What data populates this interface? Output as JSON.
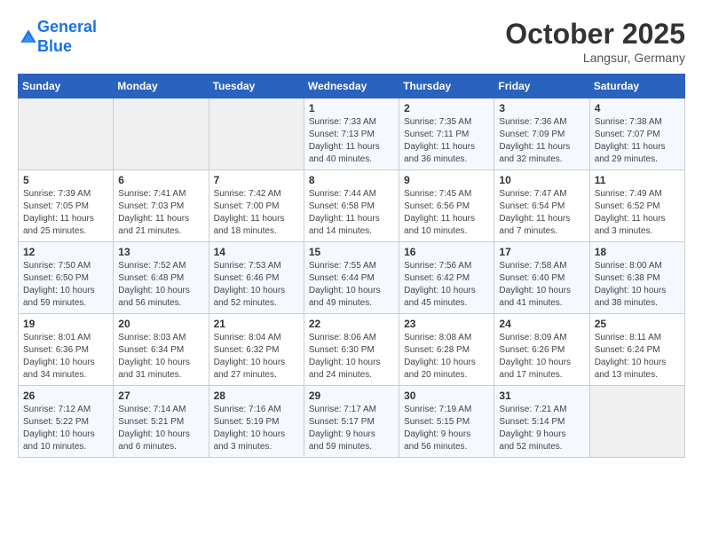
{
  "header": {
    "logo_line1": "General",
    "logo_line2": "Blue",
    "month": "October 2025",
    "location": "Langsur, Germany"
  },
  "weekdays": [
    "Sunday",
    "Monday",
    "Tuesday",
    "Wednesday",
    "Thursday",
    "Friday",
    "Saturday"
  ],
  "weeks": [
    [
      {
        "day": "",
        "info": ""
      },
      {
        "day": "",
        "info": ""
      },
      {
        "day": "",
        "info": ""
      },
      {
        "day": "1",
        "info": "Sunrise: 7:33 AM\nSunset: 7:13 PM\nDaylight: 11 hours\nand 40 minutes."
      },
      {
        "day": "2",
        "info": "Sunrise: 7:35 AM\nSunset: 7:11 PM\nDaylight: 11 hours\nand 36 minutes."
      },
      {
        "day": "3",
        "info": "Sunrise: 7:36 AM\nSunset: 7:09 PM\nDaylight: 11 hours\nand 32 minutes."
      },
      {
        "day": "4",
        "info": "Sunrise: 7:38 AM\nSunset: 7:07 PM\nDaylight: 11 hours\nand 29 minutes."
      }
    ],
    [
      {
        "day": "5",
        "info": "Sunrise: 7:39 AM\nSunset: 7:05 PM\nDaylight: 11 hours\nand 25 minutes."
      },
      {
        "day": "6",
        "info": "Sunrise: 7:41 AM\nSunset: 7:03 PM\nDaylight: 11 hours\nand 21 minutes."
      },
      {
        "day": "7",
        "info": "Sunrise: 7:42 AM\nSunset: 7:00 PM\nDaylight: 11 hours\nand 18 minutes."
      },
      {
        "day": "8",
        "info": "Sunrise: 7:44 AM\nSunset: 6:58 PM\nDaylight: 11 hours\nand 14 minutes."
      },
      {
        "day": "9",
        "info": "Sunrise: 7:45 AM\nSunset: 6:56 PM\nDaylight: 11 hours\nand 10 minutes."
      },
      {
        "day": "10",
        "info": "Sunrise: 7:47 AM\nSunset: 6:54 PM\nDaylight: 11 hours\nand 7 minutes."
      },
      {
        "day": "11",
        "info": "Sunrise: 7:49 AM\nSunset: 6:52 PM\nDaylight: 11 hours\nand 3 minutes."
      }
    ],
    [
      {
        "day": "12",
        "info": "Sunrise: 7:50 AM\nSunset: 6:50 PM\nDaylight: 10 hours\nand 59 minutes."
      },
      {
        "day": "13",
        "info": "Sunrise: 7:52 AM\nSunset: 6:48 PM\nDaylight: 10 hours\nand 56 minutes."
      },
      {
        "day": "14",
        "info": "Sunrise: 7:53 AM\nSunset: 6:46 PM\nDaylight: 10 hours\nand 52 minutes."
      },
      {
        "day": "15",
        "info": "Sunrise: 7:55 AM\nSunset: 6:44 PM\nDaylight: 10 hours\nand 49 minutes."
      },
      {
        "day": "16",
        "info": "Sunrise: 7:56 AM\nSunset: 6:42 PM\nDaylight: 10 hours\nand 45 minutes."
      },
      {
        "day": "17",
        "info": "Sunrise: 7:58 AM\nSunset: 6:40 PM\nDaylight: 10 hours\nand 41 minutes."
      },
      {
        "day": "18",
        "info": "Sunrise: 8:00 AM\nSunset: 6:38 PM\nDaylight: 10 hours\nand 38 minutes."
      }
    ],
    [
      {
        "day": "19",
        "info": "Sunrise: 8:01 AM\nSunset: 6:36 PM\nDaylight: 10 hours\nand 34 minutes."
      },
      {
        "day": "20",
        "info": "Sunrise: 8:03 AM\nSunset: 6:34 PM\nDaylight: 10 hours\nand 31 minutes."
      },
      {
        "day": "21",
        "info": "Sunrise: 8:04 AM\nSunset: 6:32 PM\nDaylight: 10 hours\nand 27 minutes."
      },
      {
        "day": "22",
        "info": "Sunrise: 8:06 AM\nSunset: 6:30 PM\nDaylight: 10 hours\nand 24 minutes."
      },
      {
        "day": "23",
        "info": "Sunrise: 8:08 AM\nSunset: 6:28 PM\nDaylight: 10 hours\nand 20 minutes."
      },
      {
        "day": "24",
        "info": "Sunrise: 8:09 AM\nSunset: 6:26 PM\nDaylight: 10 hours\nand 17 minutes."
      },
      {
        "day": "25",
        "info": "Sunrise: 8:11 AM\nSunset: 6:24 PM\nDaylight: 10 hours\nand 13 minutes."
      }
    ],
    [
      {
        "day": "26",
        "info": "Sunrise: 7:12 AM\nSunset: 5:22 PM\nDaylight: 10 hours\nand 10 minutes."
      },
      {
        "day": "27",
        "info": "Sunrise: 7:14 AM\nSunset: 5:21 PM\nDaylight: 10 hours\nand 6 minutes."
      },
      {
        "day": "28",
        "info": "Sunrise: 7:16 AM\nSunset: 5:19 PM\nDaylight: 10 hours\nand 3 minutes."
      },
      {
        "day": "29",
        "info": "Sunrise: 7:17 AM\nSunset: 5:17 PM\nDaylight: 9 hours\nand 59 minutes."
      },
      {
        "day": "30",
        "info": "Sunrise: 7:19 AM\nSunset: 5:15 PM\nDaylight: 9 hours\nand 56 minutes."
      },
      {
        "day": "31",
        "info": "Sunrise: 7:21 AM\nSunset: 5:14 PM\nDaylight: 9 hours\nand 52 minutes."
      },
      {
        "day": "",
        "info": ""
      }
    ]
  ]
}
